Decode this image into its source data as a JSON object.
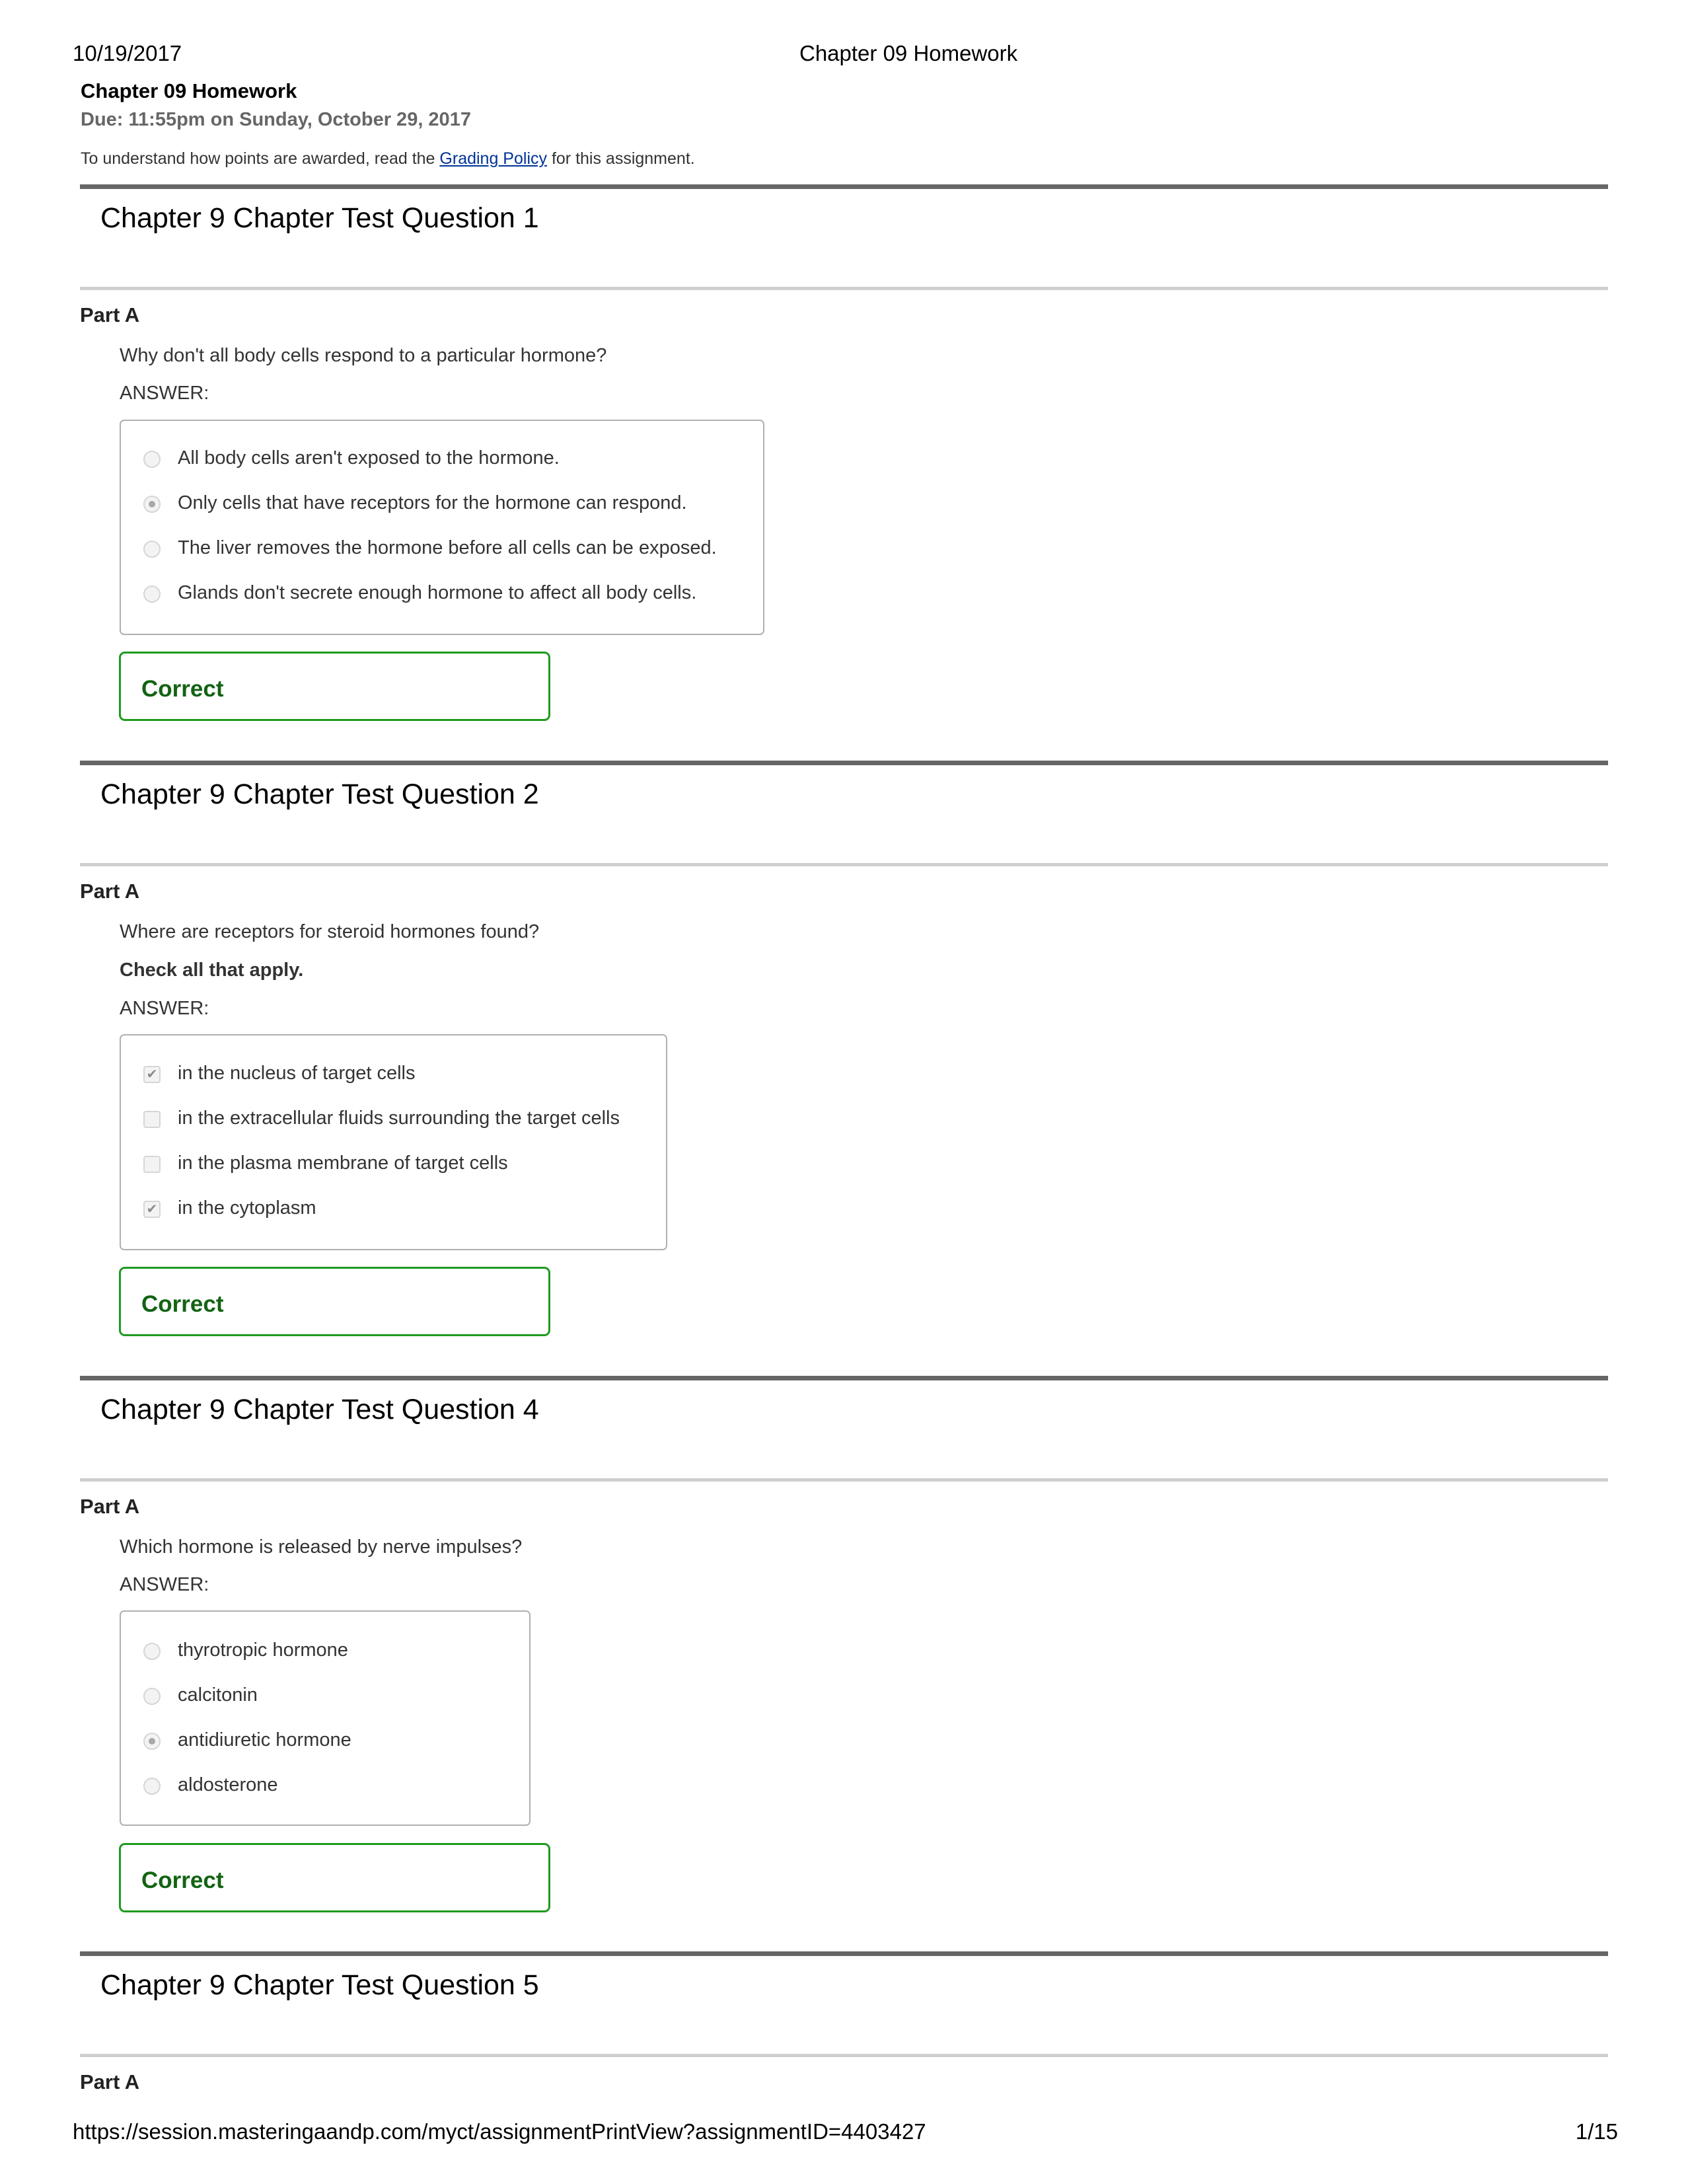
{
  "print_header": {
    "date": "10/19/2017",
    "title": "Chapter 09 Homework"
  },
  "assignment": {
    "title": "Chapter 09 Homework",
    "due": "Due: 11:55pm on Sunday, October 29, 2017",
    "info_prefix": "To understand how points are awarded, read the ",
    "info_link": "Grading Policy",
    "info_suffix": " for this assignment."
  },
  "questions": [
    {
      "title": "Chapter 9 Chapter Test Question 1",
      "part": "Part A",
      "text": "Why don't all body cells respond to a particular hormone?",
      "instruction": "",
      "answer_label": "ANSWER:",
      "input_type": "radio",
      "options": [
        {
          "label": "All body cells aren't exposed to the hormone.",
          "selected": false
        },
        {
          "label": "Only cells that have receptors for the hormone can respond.",
          "selected": true
        },
        {
          "label": "The liver removes the hormone before all cells can be exposed.",
          "selected": false
        },
        {
          "label": "Glands don't secrete enough hormone to affect all body cells.",
          "selected": false
        }
      ],
      "result": "Correct"
    },
    {
      "title": "Chapter 9 Chapter Test Question 2",
      "part": "Part A",
      "text": "Where are receptors for steroid hormones found?",
      "instruction": "Check all that apply.",
      "answer_label": "ANSWER:",
      "input_type": "checkbox",
      "options": [
        {
          "label": "in the nucleus of target cells",
          "selected": true
        },
        {
          "label": "in the extracellular fluids surrounding the target cells",
          "selected": false
        },
        {
          "label": "in the plasma membrane of target cells",
          "selected": false
        },
        {
          "label": "in the cytoplasm",
          "selected": true
        }
      ],
      "result": "Correct"
    },
    {
      "title": "Chapter 9 Chapter Test Question 4",
      "part": "Part A",
      "text": "Which hormone is released by nerve impulses?",
      "instruction": "",
      "answer_label": "ANSWER:",
      "input_type": "radio",
      "options": [
        {
          "label": "thyrotropic hormone",
          "selected": false
        },
        {
          "label": "calcitonin",
          "selected": false
        },
        {
          "label": "antidiuretic hormone",
          "selected": true
        },
        {
          "label": "aldosterone",
          "selected": false
        }
      ],
      "result": "Correct"
    },
    {
      "title": "Chapter 9 Chapter Test Question 5",
      "part": "Part A"
    }
  ],
  "print_footer": {
    "url": "https://session.masteringaandp.com/myct/assignmentPrintView?assignmentID=4403427",
    "page": "1/15"
  },
  "colors": {
    "correct_border": "#1f9a1f",
    "correct_text": "#136313",
    "link": "#003399"
  },
  "icons": {
    "check_glyph": "✔"
  }
}
